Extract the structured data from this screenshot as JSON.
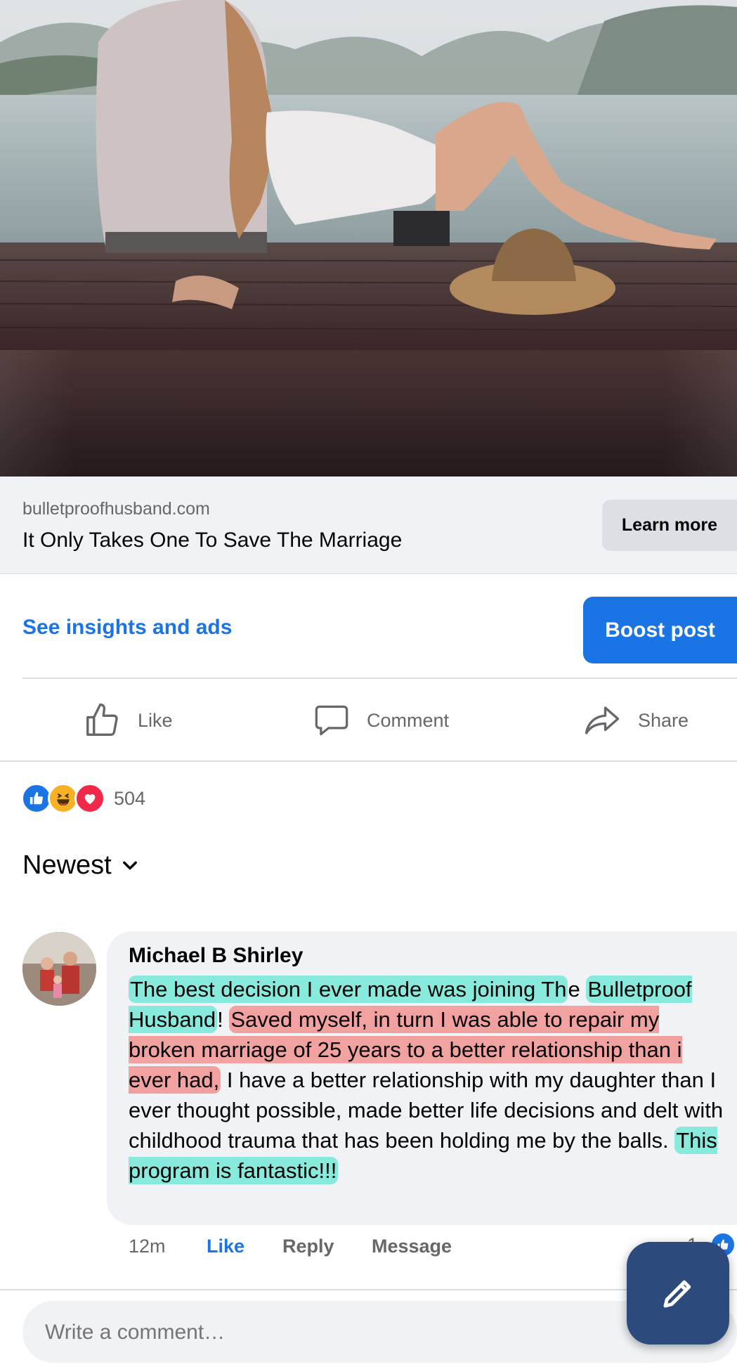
{
  "hero": {
    "image": "couple sitting on dock by lake"
  },
  "link_preview": {
    "domain": "bulletproofhusband.com",
    "title": "It Only Takes One To Save The Marriage",
    "cta_label": "Learn more"
  },
  "insights": {
    "link_label": "See insights and ads",
    "boost_label": "Boost post"
  },
  "actions": {
    "like": "Like",
    "comment": "Comment",
    "share": "Share"
  },
  "reactions": {
    "icons": [
      "like-icon",
      "haha-icon",
      "love-icon"
    ],
    "count": "504"
  },
  "sort": {
    "label": "Newest"
  },
  "comment": {
    "author": "Michael B Shirley",
    "segments": [
      {
        "text": "The best decision I ever made was joining Th",
        "highlight": "cyan"
      },
      {
        "text": "e ",
        "highlight": "none"
      },
      {
        "text": "Bulletproof Husband",
        "highlight": "cyan"
      },
      {
        "text": "! ",
        "highlight": "none"
      },
      {
        "text": "Saved myself, in turn I was able to repair my broken marriage of 25 years to a better relationship than i ever  had,",
        "highlight": "red"
      },
      {
        "text": " I have a better relationship with my daughter than I ever thought possible, made better life decisions and delt with childhood trauma that has been holding me by the balls. ",
        "highlight": "none"
      },
      {
        "text": "This program is fantastic!!!",
        "highlight": "cyan"
      }
    ],
    "time": "12m",
    "like_label": "Like",
    "reply_label": "Reply",
    "message_label": "Message",
    "reaction_count": "1"
  },
  "composer": {
    "placeholder": "Write a comment…"
  },
  "colors": {
    "accent": "#1b74e4",
    "highlight_cyan": "#76e8d8",
    "highlight_red": "#f28c8c",
    "fab": "#2c4a7c"
  }
}
